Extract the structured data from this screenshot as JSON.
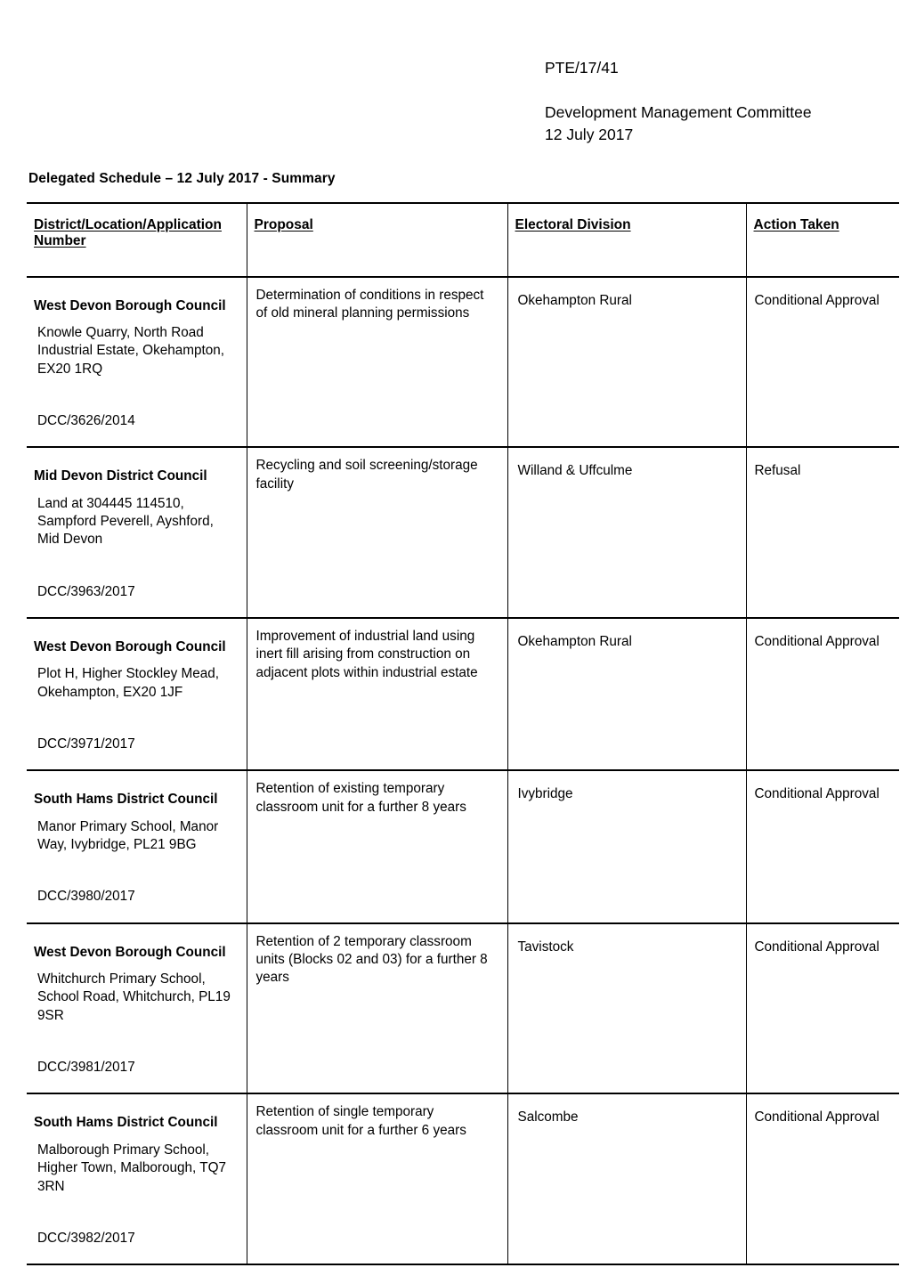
{
  "document": {
    "reference": "PTE/17/41",
    "committee_name": "Development Management Committee",
    "committee_date": "12 July 2017",
    "schedule_caption": "Delegated Schedule – 12 July 2017 - Summary"
  },
  "table": {
    "columns": [
      {
        "key": "district",
        "label": "District/Location/Application Number"
      },
      {
        "key": "proposal",
        "label": "Proposal"
      },
      {
        "key": "division",
        "label": "Electoral Division"
      },
      {
        "key": "action",
        "label": "Action Taken"
      }
    ],
    "rows": [
      {
        "council": "West Devon Borough Council",
        "address": "Knowle Quarry, North Road Industrial Estate, Okehampton, EX20 1RQ",
        "application_number": "DCC/3626/2014",
        "proposal": "Determination of conditions in respect of old mineral planning permissions",
        "electoral_division": "Okehampton Rural",
        "action_taken": "Conditional Approval"
      },
      {
        "council": "Mid Devon District Council",
        "address": "Land at 304445 114510, Sampford Peverell, Ayshford, Mid Devon",
        "application_number": "DCC/3963/2017",
        "proposal": "Recycling and soil screening/storage facility",
        "electoral_division": "Willand & Uffculme",
        "action_taken": "Refusal"
      },
      {
        "council": "West Devon Borough Council",
        "address": "Plot H, Higher Stockley Mead, Okehampton, EX20 1JF",
        "application_number": "DCC/3971/2017",
        "proposal": "Improvement of industrial land using inert fill arising from construction on adjacent plots within industrial estate",
        "electoral_division": "Okehampton Rural",
        "action_taken": "Conditional Approval"
      },
      {
        "council": "South Hams District Council",
        "address": "Manor Primary School, Manor Way, Ivybridge, PL21 9BG",
        "application_number": "DCC/3980/2017",
        "proposal": "Retention of existing temporary classroom unit for a further 8 years",
        "electoral_division": "Ivybridge",
        "action_taken": "Conditional Approval"
      },
      {
        "council": "West Devon Borough Council",
        "address": "Whitchurch Primary School, School Road, Whitchurch, PL19 9SR",
        "application_number": "DCC/3981/2017",
        "proposal": "Retention of 2 temporary classroom units (Blocks 02 and 03) for a further 8 years",
        "electoral_division": "Tavistock",
        "action_taken": "Conditional Approval"
      },
      {
        "council": "South Hams District Council",
        "address": "Malborough Primary School, Higher Town, Malborough, TQ7 3RN",
        "application_number": "DCC/3982/2017",
        "proposal": "Retention of single temporary classroom unit for a further 6 years",
        "electoral_division": "Salcombe",
        "action_taken": "Conditional Approval"
      }
    ]
  }
}
